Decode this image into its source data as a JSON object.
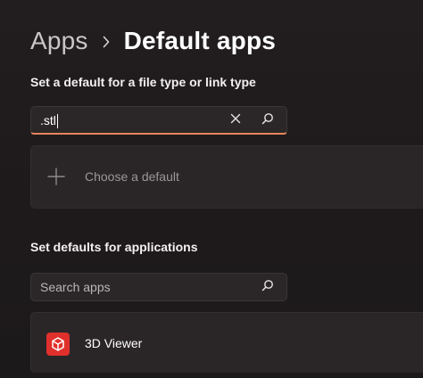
{
  "header": {
    "parent": "Apps",
    "current": "Default apps"
  },
  "filetype_section": {
    "title": "Set a default for a file type or link type",
    "search_value": ".stl",
    "choose_label": "Choose a default"
  },
  "apps_section": {
    "title": "Set defaults for applications",
    "search_placeholder": "Search apps",
    "apps": [
      {
        "name": "3D Viewer",
        "icon": "3d-viewer-icon",
        "icon_color": "#e0302b"
      }
    ]
  },
  "colors": {
    "accent_underline": "#e8865a",
    "background": "#1e1b1d",
    "card": "#2a2628"
  }
}
